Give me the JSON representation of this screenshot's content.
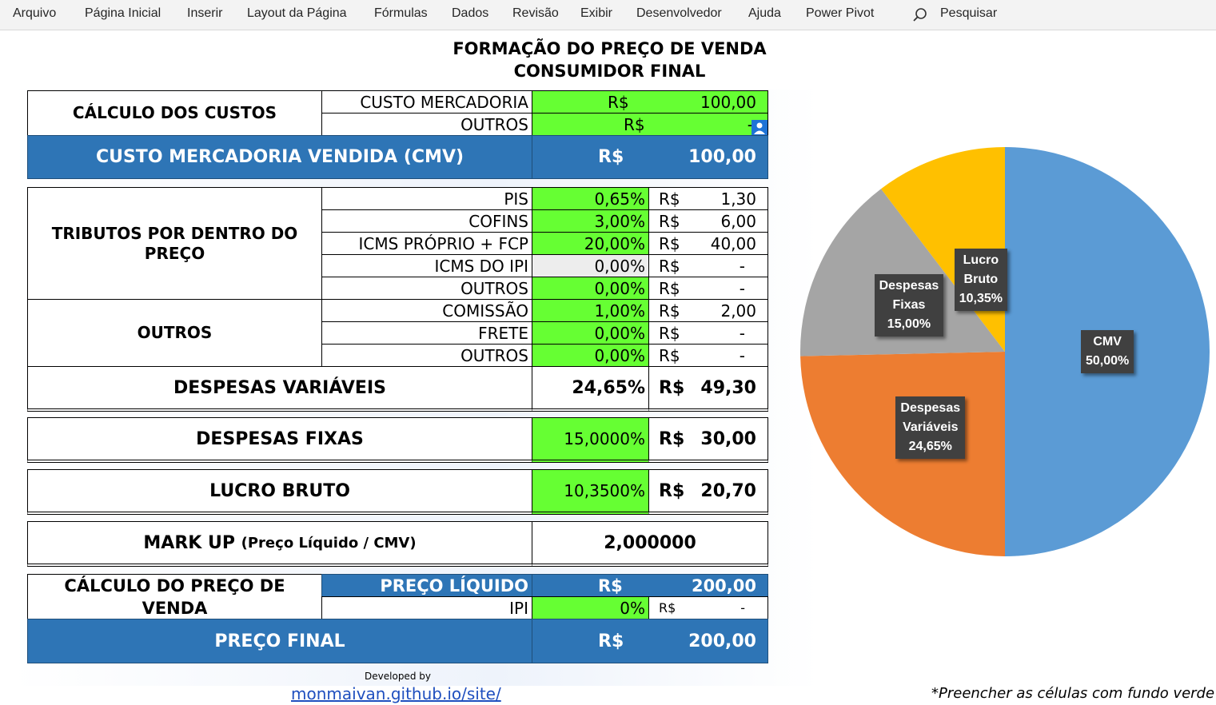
{
  "menu": {
    "items": [
      "Arquivo",
      "Página Inicial",
      "Inserir",
      "Layout da Página",
      "Fórmulas",
      "Dados",
      "Revisão",
      "Exibir",
      "Desenvolvedor",
      "Ajuda",
      "Power Pivot"
    ],
    "search_label": "Pesquisar"
  },
  "title": {
    "line1": "FORMAÇÃO DO PREÇO DE VENDA",
    "line2": "CONSUMIDOR FINAL"
  },
  "custos": {
    "header": "CÁLCULO DOS CUSTOS",
    "rows": [
      {
        "label": "CUSTO MERCADORIA",
        "currency": "R$",
        "value": "100,00"
      },
      {
        "label": "OUTROS",
        "currency": "R$",
        "value": "-"
      }
    ],
    "cmv_label": "CUSTO MERCADORIA VENDIDA (CMV)",
    "cmv_currency": "R$",
    "cmv_value": "100,00"
  },
  "tributos": {
    "header": "TRIBUTOS POR DENTRO DO PREÇO",
    "rows": [
      {
        "label": "PIS",
        "pct": "0,65%",
        "currency": "R$",
        "value": "1,30"
      },
      {
        "label": "COFINS",
        "pct": "3,00%",
        "currency": "R$",
        "value": "6,00"
      },
      {
        "label": "ICMS PRÓPRIO + FCP",
        "pct": "20,00%",
        "currency": "R$",
        "value": "40,00"
      },
      {
        "label": "ICMS DO IPI",
        "pct": "0,00%",
        "currency": "R$",
        "value": "-"
      },
      {
        "label": "OUTROS",
        "pct": "0,00%",
        "currency": "R$",
        "value": "-"
      }
    ]
  },
  "outros": {
    "header": "OUTROS",
    "rows": [
      {
        "label": "COMISSÃO",
        "pct": "1,00%",
        "currency": "R$",
        "value": "2,00"
      },
      {
        "label": "FRETE",
        "pct": "0,00%",
        "currency": "R$",
        "value": "-"
      },
      {
        "label": "OUTROS",
        "pct": "0,00%",
        "currency": "R$",
        "value": "-"
      }
    ]
  },
  "despesas_variaveis": {
    "label": "DESPESAS VARIÁVEIS",
    "pct": "24,65%",
    "currency": "R$",
    "value": "49,30"
  },
  "despesas_fixas": {
    "label": "DESPESAS FIXAS",
    "pct": "15,0000%",
    "currency": "R$",
    "value": "30,00"
  },
  "lucro_bruto": {
    "label": "LUCRO BRUTO",
    "pct": "10,3500%",
    "currency": "R$",
    "value": "20,70"
  },
  "markup": {
    "label": "MARK UP",
    "sublabel": "(Preço Líquido / CMV)",
    "value": "2,000000"
  },
  "preco": {
    "header": "CÁLCULO DO PREÇO DE VENDA",
    "liquido_label": "PREÇO LÍQUIDO",
    "liquido_currency": "R$",
    "liquido_value": "200,00",
    "ipi_label": "IPI",
    "ipi_pct": "0%",
    "ipi_currency": "R$",
    "ipi_value": "-",
    "final_label": "PREÇO FINAL",
    "final_currency": "R$",
    "final_value": "200,00"
  },
  "footer": {
    "developed_by": "Developed by",
    "link": "monmaivan.github.io/site/",
    "note": "*Preencher as células com fundo verde"
  },
  "colors": {
    "green": "#66ff33",
    "blue": "#2e75b6",
    "cmv": "#5b9bd5",
    "despesas_variaveis": "#ed7d31",
    "despesas_fixas": "#a5a5a5",
    "lucro_bruto": "#ffc000"
  },
  "chart_data": {
    "type": "pie",
    "categories": [
      "CMV",
      "Despesas Variáveis",
      "Despesas Fixas",
      "Lucro Bruto"
    ],
    "values": [
      50.0,
      24.65,
      15.0,
      10.35
    ],
    "labels": [
      {
        "name": "CMV",
        "pct": "50,00%"
      },
      {
        "name": "Despesas Variáveis",
        "pct": "24,65%"
      },
      {
        "name": "Despesas Fixas",
        "pct": "15,00%"
      },
      {
        "name": "Lucro Bruto",
        "pct": "10,35%"
      }
    ],
    "colors": [
      "#5b9bd5",
      "#ed7d31",
      "#a5a5a5",
      "#ffc000"
    ]
  }
}
